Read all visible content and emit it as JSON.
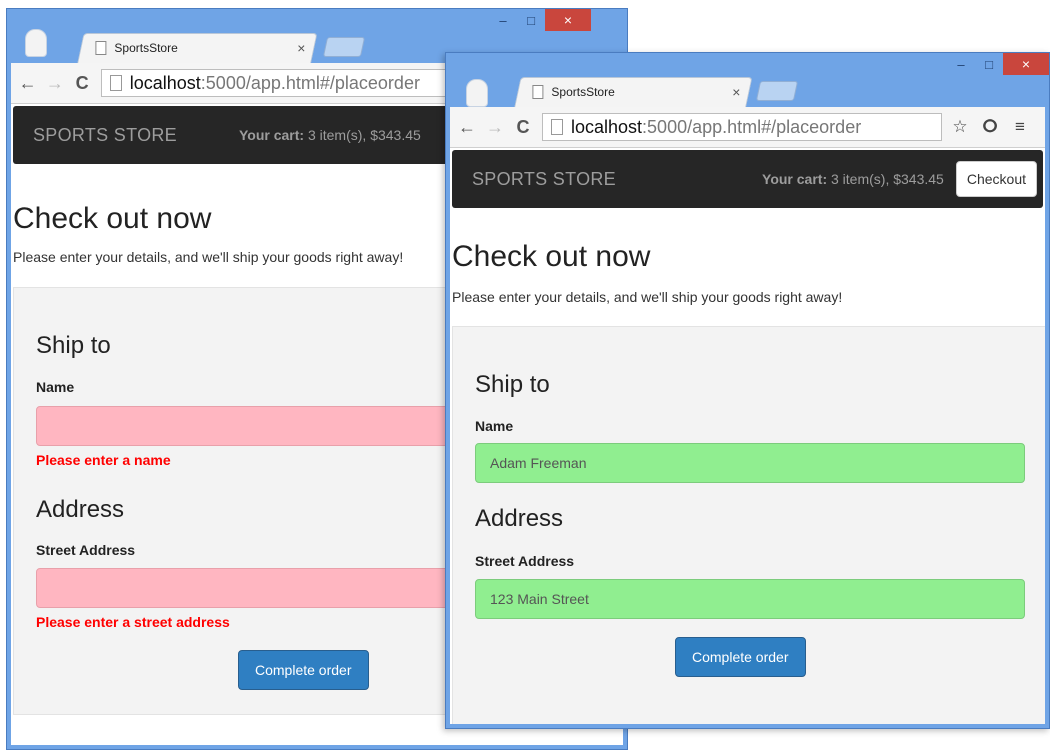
{
  "browser": {
    "tab_title": "SportsStore",
    "tab_close": "×",
    "url_host": "localhost",
    "url_rest": ":5000/app.html#/placeorder",
    "btn_back": "←",
    "btn_forward": "→",
    "btn_reload": "C",
    "btn_minimize": "–",
    "btn_maximize": "□",
    "btn_close": "×",
    "icon_star": "☆",
    "icon_extension": "ⵔ",
    "icon_menu": "≡"
  },
  "navbar": {
    "brand": "SPORTS STORE",
    "cart_label": "Your cart:",
    "cart_summary": "3 item(s), $343.45",
    "checkout_button": "Checkout"
  },
  "page": {
    "title": "Check out now",
    "lead": "Please enter your details, and we'll ship your goods right away!",
    "ship_heading": "Ship to",
    "name_label": "Name",
    "address_heading": "Address",
    "street_label": "Street Address",
    "submit_button": "Complete order"
  },
  "invalid_form": {
    "name_value": "",
    "name_error": "Please enter a name",
    "street_value": "",
    "street_error": "Please enter a street address"
  },
  "valid_form": {
    "name_value": "Adam Freeman",
    "street_value": "123 Main Street"
  },
  "colors": {
    "window_frame": "#6fa4e6",
    "close_button": "#c9463d",
    "navbar": "#262626",
    "invalid_field": "#ffb6c1",
    "valid_field": "#90ee90",
    "error_text": "#ff0000",
    "primary_button": "#2f7fc2"
  }
}
